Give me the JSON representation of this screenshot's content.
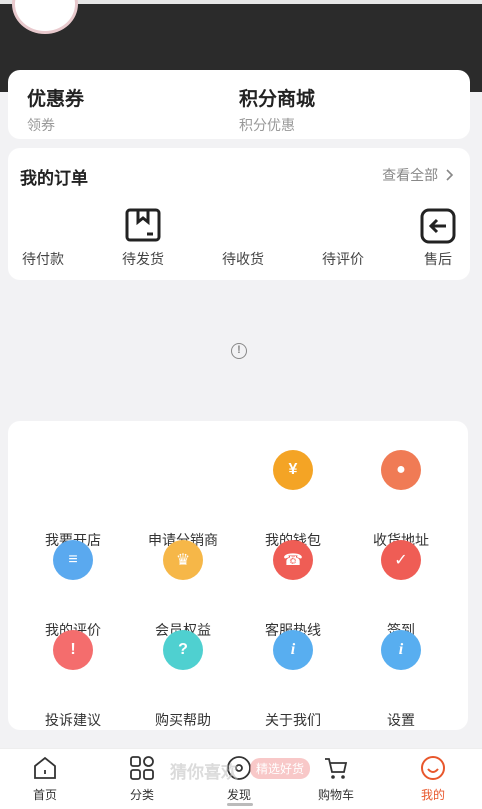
{
  "coupons": [
    {
      "title": "优惠券",
      "sub": "领券"
    },
    {
      "title": "积分商城",
      "sub": "积分优惠"
    }
  ],
  "orders": {
    "title": "我的订单",
    "view_all": "查看全部",
    "items": [
      {
        "label": "待付款",
        "icon": "wallet-icon"
      },
      {
        "label": "待发货",
        "icon": "package-icon"
      },
      {
        "label": "待收货",
        "icon": "truck-icon"
      },
      {
        "label": "待评价",
        "icon": "comment-icon"
      },
      {
        "label": "售后",
        "icon": "return-icon"
      }
    ]
  },
  "info_glyph": "!",
  "services": [
    {
      "label": "我要开店",
      "icon": "shop-icon",
      "color": ""
    },
    {
      "label": "申请分销商",
      "icon": "distributor-icon",
      "color": ""
    },
    {
      "label": "我的钱包",
      "icon": "wallet-coin-icon",
      "color": "#f4a425",
      "glyph": "¥"
    },
    {
      "label": "收货地址",
      "icon": "location-pin-icon",
      "color": "#f07b55",
      "glyph": "●"
    },
    {
      "label": "我的评价",
      "icon": "document-icon",
      "color": "#5aa9ef",
      "glyph": "≡"
    },
    {
      "label": "会员权益",
      "icon": "crown-icon",
      "color": "#f6b748",
      "glyph": "♛"
    },
    {
      "label": "客服热线",
      "icon": "headset-icon",
      "color": "#ef5d55",
      "glyph": "☎"
    },
    {
      "label": "签到",
      "icon": "calendar-check-icon",
      "color": "#ef5d55",
      "glyph": "✓"
    },
    {
      "label": "投诉建议",
      "icon": "warning-icon",
      "color": "#f46d6d",
      "glyph": "!"
    },
    {
      "label": "购买帮助",
      "icon": "help-icon",
      "color": "#4fd0d0",
      "glyph": "?"
    },
    {
      "label": "关于我们",
      "icon": "info-icon",
      "color": "#58aef0",
      "glyph": "i"
    },
    {
      "label": "设置",
      "icon": "settings-info-icon",
      "color": "#58aef0",
      "glyph": "i"
    }
  ],
  "watermark": {
    "text": "猜你喜欢",
    "badge": "精选好货"
  },
  "tabs": [
    {
      "label": "首页",
      "icon": "home-icon"
    },
    {
      "label": "分类",
      "icon": "category-icon"
    },
    {
      "label": "发现",
      "icon": "compass-icon"
    },
    {
      "label": "购物车",
      "icon": "cart-icon"
    },
    {
      "label": "我的",
      "icon": "profile-icon",
      "active": true
    }
  ],
  "colors": {
    "accent": "#e8572c",
    "header": "#2b2b2b",
    "background": "#f2f2f4"
  }
}
